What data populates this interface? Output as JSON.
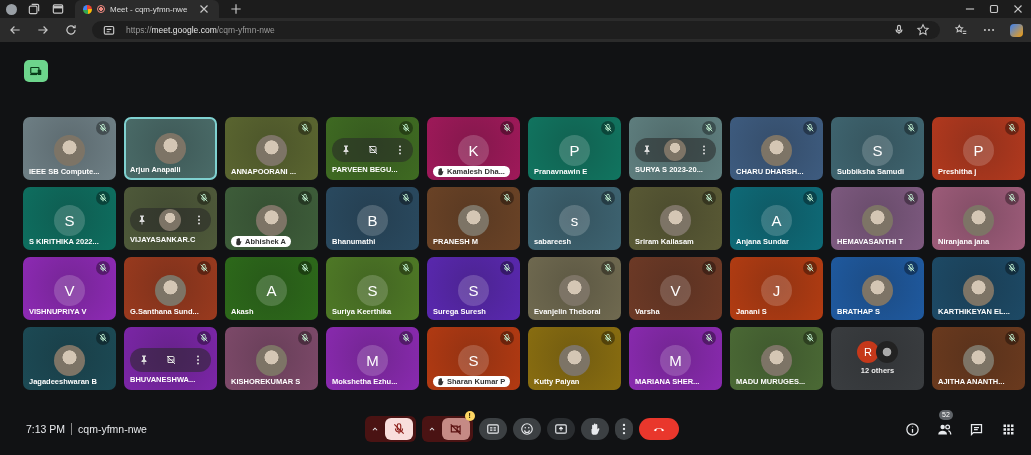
{
  "browser": {
    "tab": {
      "title": "Meet - cqm-yfmn-nwe",
      "recording": true
    },
    "url": "https://**meet.google.com**/cqm-yfmn-nwe"
  },
  "tiles": [
    {
      "kind": "person",
      "name": "IEEE SB Compute...",
      "color": "#6f8086",
      "avatar": {
        "kind": "photo"
      },
      "muted": true,
      "speaking": false,
      "hand_raised": false,
      "hover_controls": false
    },
    {
      "kind": "person",
      "name": "Arjun Anapalli",
      "color": "#4a6b68",
      "avatar": {
        "kind": "photo"
      },
      "muted": false,
      "speaking": true,
      "hand_raised": false,
      "hover_controls": false
    },
    {
      "kind": "person",
      "name": "ANNAPOORANI ...",
      "color": "#5b6630",
      "avatar": {
        "kind": "photo"
      },
      "muted": true,
      "speaking": false,
      "hand_raised": false,
      "hover_controls": false
    },
    {
      "kind": "person",
      "name": "PARVEEN BEGU...",
      "color": "#3f6b22",
      "muted": true,
      "speaking": false,
      "hand_raised": false,
      "hover_controls": true
    },
    {
      "kind": "person",
      "name": "Kamalesh Dha...",
      "color": "#a0195a",
      "avatar": {
        "kind": "letter",
        "letter": "K"
      },
      "muted": true,
      "speaking": false,
      "hand_raised": true,
      "hover_controls": false
    },
    {
      "kind": "person",
      "name": "Pranavnawin E",
      "color": "#117560",
      "avatar": {
        "kind": "letter",
        "letter": "P"
      },
      "muted": true,
      "speaking": false,
      "hand_raised": false,
      "hover_controls": false
    },
    {
      "kind": "person",
      "name": "SURYA S 2023-20...",
      "color": "#5f7f7f",
      "avatar": {
        "kind": "photo"
      },
      "muted": true,
      "speaking": false,
      "hand_raised": false,
      "hover_controls": true
    },
    {
      "kind": "person",
      "name": "CHARU DHARSH...",
      "color": "#3e5c80",
      "avatar": {
        "kind": "photo"
      },
      "muted": true,
      "speaking": false,
      "hand_raised": false,
      "hover_controls": false
    },
    {
      "kind": "person",
      "name": "Subbiksha Samudi",
      "color": "#3f6570",
      "avatar": {
        "kind": "letter",
        "letter": "S"
      },
      "muted": true,
      "speaking": false,
      "hand_raised": false,
      "hover_controls": false
    },
    {
      "kind": "person",
      "name": "Preshitha j",
      "color": "#b3391e",
      "avatar": {
        "kind": "letter",
        "letter": "P"
      },
      "muted": true,
      "speaking": false,
      "hand_raised": false,
      "hover_controls": false
    },
    {
      "kind": "person",
      "name": "S KIRITHIKA 2022...",
      "color": "#0e6f60",
      "avatar": {
        "kind": "letter",
        "letter": "S"
      },
      "muted": true,
      "speaking": false,
      "hand_raised": false,
      "hover_controls": false
    },
    {
      "kind": "person",
      "name": "VIJAYASANKAR.C",
      "color": "#4f5a3a",
      "avatar": {
        "kind": "photo"
      },
      "muted": true,
      "speaking": false,
      "hand_raised": false,
      "hover_controls": true
    },
    {
      "kind": "person",
      "name": "Abhishek A",
      "color": "#3e5e3a",
      "avatar": {
        "kind": "photo"
      },
      "muted": true,
      "speaking": false,
      "hand_raised": true,
      "hover_controls": false
    },
    {
      "kind": "person",
      "name": "Bhanumathi",
      "color": "#2a4a60",
      "avatar": {
        "kind": "letter",
        "letter": "B"
      },
      "muted": true,
      "speaking": false,
      "hand_raised": false,
      "hover_controls": false
    },
    {
      "kind": "person",
      "name": "PRANESH M",
      "color": "#6b4326",
      "avatar": {
        "kind": "photo"
      },
      "muted": true,
      "speaking": false,
      "hand_raised": false,
      "hover_controls": false
    },
    {
      "kind": "person",
      "name": "sabareesh",
      "color": "#3e6472",
      "avatar": {
        "kind": "letter",
        "letter": "s"
      },
      "muted": true,
      "speaking": false,
      "hand_raised": false,
      "hover_controls": false
    },
    {
      "kind": "person",
      "name": "Sriram Kailasam",
      "color": "#5a5a35",
      "avatar": {
        "kind": "photo"
      },
      "muted": true,
      "speaking": false,
      "hand_raised": false,
      "hover_controls": false
    },
    {
      "kind": "person",
      "name": "Anjana Sundar",
      "color": "#0e6b78",
      "avatar": {
        "kind": "letter",
        "letter": "A"
      },
      "muted": true,
      "speaking": false,
      "hand_raised": false,
      "hover_controls": false
    },
    {
      "kind": "person",
      "name": "HEMAVASANTHI T",
      "color": "#7e5a80",
      "avatar": {
        "kind": "photo"
      },
      "muted": true,
      "speaking": false,
      "hand_raised": false,
      "hover_controls": false
    },
    {
      "kind": "person",
      "name": "Niranjana jana",
      "color": "#9e5c7a",
      "avatar": {
        "kind": "photo"
      },
      "muted": true,
      "speaking": false,
      "hand_raised": false,
      "hover_controls": false
    },
    {
      "kind": "person",
      "name": "VISHNUPRIYA V",
      "color": "#8e2ab5",
      "avatar": {
        "kind": "letter",
        "letter": "V"
      },
      "muted": true,
      "speaking": false,
      "hand_raised": false,
      "hover_controls": false
    },
    {
      "kind": "person",
      "name": "G.Santhana Sund...",
      "color": "#9a3a1e",
      "avatar": {
        "kind": "photo"
      },
      "muted": true,
      "speaking": false,
      "hand_raised": false,
      "hover_controls": false
    },
    {
      "kind": "person",
      "name": "Akash",
      "color": "#2d6a1a",
      "avatar": {
        "kind": "letter",
        "letter": "A"
      },
      "muted": true,
      "speaking": false,
      "hand_raised": false,
      "hover_controls": false
    },
    {
      "kind": "person",
      "name": "Suriya Keerthika",
      "color": "#4f7a26",
      "avatar": {
        "kind": "letter",
        "letter": "S"
      },
      "muted": true,
      "speaking": false,
      "hand_raised": false,
      "hover_controls": false
    },
    {
      "kind": "person",
      "name": "Surega Suresh",
      "color": "#5a28b0",
      "avatar": {
        "kind": "letter",
        "letter": "S"
      },
      "muted": true,
      "speaking": false,
      "hand_raised": false,
      "hover_controls": false
    },
    {
      "kind": "person",
      "name": "Evanjelin Theboral",
      "color": "#706a50",
      "avatar": {
        "kind": "photo"
      },
      "muted": true,
      "speaking": false,
      "hand_raised": false,
      "hover_controls": false
    },
    {
      "kind": "person",
      "name": "Varsha",
      "color": "#6e3a26",
      "avatar": {
        "kind": "letter",
        "letter": "V"
      },
      "muted": true,
      "speaking": false,
      "hand_raised": false,
      "hover_controls": false
    },
    {
      "kind": "person",
      "name": "Janani S",
      "color": "#b33c12",
      "avatar": {
        "kind": "letter",
        "letter": "J"
      },
      "muted": true,
      "speaking": false,
      "hand_raised": false,
      "hover_controls": false
    },
    {
      "kind": "person",
      "name": "BRATHAP S",
      "color": "#1f5aa0",
      "avatar": {
        "kind": "photo"
      },
      "muted": true,
      "speaking": false,
      "hand_raised": false,
      "hover_controls": false
    },
    {
      "kind": "person",
      "name": "KARTHIKEYAN EL...",
      "color": "#1d4a66",
      "avatar": {
        "kind": "photo"
      },
      "muted": true,
      "speaking": false,
      "hand_raised": false,
      "hover_controls": false
    },
    {
      "kind": "person",
      "name": "Jagadeeshwaran B",
      "color": "#1c4a55",
      "avatar": {
        "kind": "photo"
      },
      "muted": true,
      "speaking": false,
      "hand_raised": false,
      "hover_controls": false
    },
    {
      "kind": "person",
      "name": "BHUVANESHWA...",
      "color": "#7c26a8",
      "muted": true,
      "speaking": false,
      "hand_raised": false,
      "hover_controls": true
    },
    {
      "kind": "person",
      "name": "KISHOREKUMAR S",
      "color": "#7e4a6a",
      "avatar": {
        "kind": "photo"
      },
      "muted": true,
      "speaking": false,
      "hand_raised": false,
      "hover_controls": false
    },
    {
      "kind": "person",
      "name": "Mokshetha Ezhu...",
      "color": "#8a2ab0",
      "avatar": {
        "kind": "letter",
        "letter": "M"
      },
      "muted": true,
      "speaking": false,
      "hand_raised": false,
      "hover_controls": false
    },
    {
      "kind": "person",
      "name": "Sharan Kumar P",
      "color": "#b33a12",
      "avatar": {
        "kind": "letter",
        "letter": "S"
      },
      "muted": true,
      "speaking": false,
      "hand_raised": true,
      "hover_controls": false
    },
    {
      "kind": "person",
      "name": "Kutty Paiyan",
      "color": "#8a6e10",
      "avatar": {
        "kind": "photo"
      },
      "muted": true,
      "speaking": false,
      "hand_raised": false,
      "hover_controls": false
    },
    {
      "kind": "person",
      "name": "MARIANA SHER...",
      "color": "#8a2ab0",
      "avatar": {
        "kind": "letter",
        "letter": "M"
      },
      "muted": true,
      "speaking": false,
      "hand_raised": false,
      "hover_controls": false
    },
    {
      "kind": "person",
      "name": "MADU MURUGES...",
      "color": "#4b6a35",
      "avatar": {
        "kind": "photo"
      },
      "muted": true,
      "speaking": false,
      "hand_raised": false,
      "hover_controls": false
    },
    {
      "kind": "group",
      "label": "12 others",
      "letter": "R",
      "color": "#3a3d40"
    },
    {
      "kind": "person",
      "name": "AJITHA ANANTH...",
      "color": "#6b3a1e",
      "avatar": {
        "kind": "photo"
      },
      "muted": true,
      "speaking": false,
      "hand_raised": false,
      "hover_controls": false
    }
  ],
  "meeting": {
    "time": "7:13 PM",
    "code": "cqm-yfmn-nwe"
  },
  "controls": [
    {
      "kind": "mic",
      "on": false
    },
    {
      "kind": "camera",
      "on": false,
      "alert": "!"
    },
    {
      "kind": "captions"
    },
    {
      "kind": "emoji"
    },
    {
      "kind": "present"
    },
    {
      "kind": "hand"
    },
    {
      "kind": "more"
    },
    {
      "kind": "leave"
    }
  ],
  "side_controls": [
    {
      "kind": "info"
    },
    {
      "kind": "people",
      "badge": "52"
    },
    {
      "kind": "chat"
    },
    {
      "kind": "activities"
    }
  ]
}
